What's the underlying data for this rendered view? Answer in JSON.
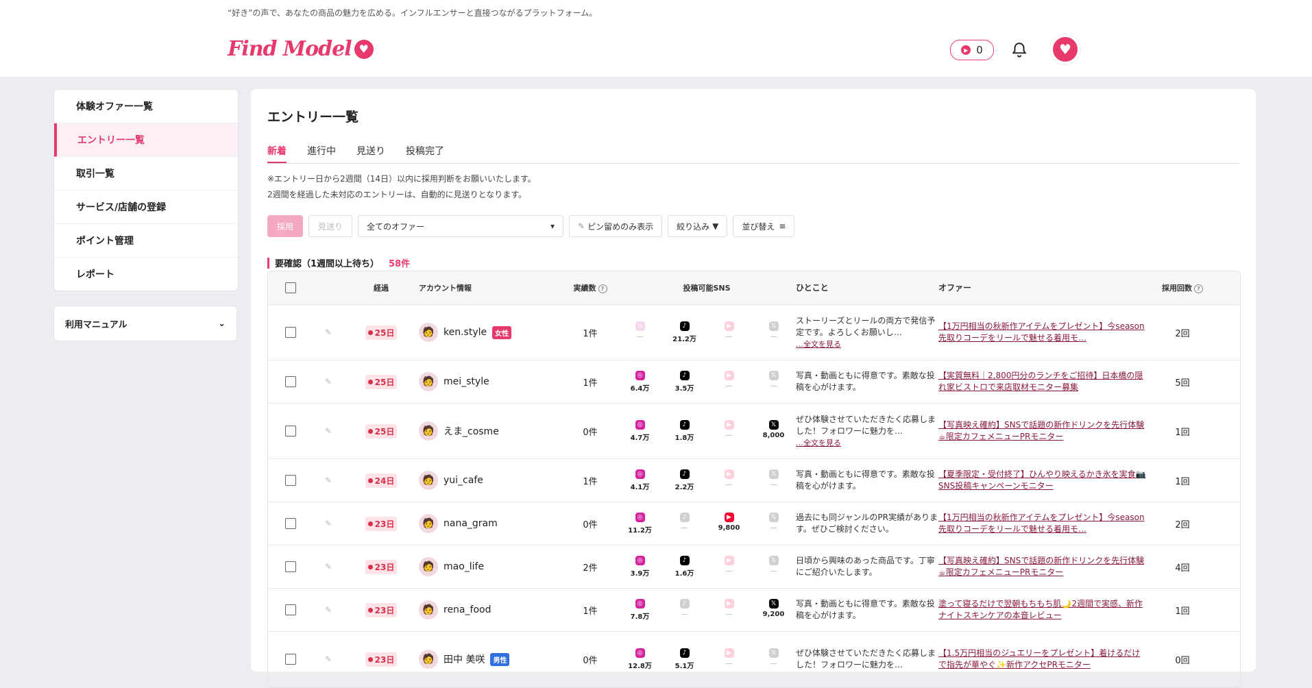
{
  "header": {
    "tagline": "“好き”の声で、あなたの商品の魅力を広める。インフルエンサーと直接つながるプラットフォーム。",
    "logo_text": "Find Model",
    "points": "0"
  },
  "sidebar": {
    "items": [
      {
        "label": "体験オファー一覧"
      },
      {
        "label": "エントリー一覧"
      },
      {
        "label": "取引一覧"
      },
      {
        "label": "サービス/店舗の登録"
      },
      {
        "label": "ポイント管理"
      },
      {
        "label": "レポート"
      }
    ],
    "manual_label": "利用マニュアル"
  },
  "main": {
    "title": "エントリー一覧",
    "tabs": [
      {
        "label": "新着"
      },
      {
        "label": "進行中"
      },
      {
        "label": "見送り"
      },
      {
        "label": "投稿完了"
      }
    ],
    "notes": [
      "※エントリー日から2週間（14日）以内に採用判断をお願いいたします。",
      "2週間を経過した未対応のエントリーは、自動的に見送りとなります。"
    ],
    "toolbar": {
      "adopt": "採用",
      "skip": "見送り",
      "offer_select": "全てのオファー",
      "pin_only": "ピン留めのみ表示",
      "filter": "絞り込み",
      "sort": "並び替え"
    },
    "section": {
      "title": "要確認（1週間以上待ち）",
      "count": "58件"
    },
    "columns": {
      "elapsed": "経過",
      "account": "アカウント情報",
      "results": "実績数",
      "sns": "投稿可能SNS",
      "message": "ひとこと",
      "offer": "オファー",
      "hire_count": "採用回数"
    },
    "more_label": "…全文を見る",
    "rows": [
      {
        "days": "25日",
        "name": "ken.style",
        "badge": "女性",
        "results": "1件",
        "ig": "—",
        "tt": "21.2万",
        "yt": "—",
        "x": "—",
        "message": "ストーリーズとリールの両方で発信予定です。よろしくお願いし…",
        "more": true,
        "offer": "【1万円相当の秋新作アイテムをプレゼント】今season先取りコーデをリールで魅せる着用モ…",
        "times": "2回"
      },
      {
        "days": "25日",
        "name": "mei_style",
        "badge": "",
        "results": "1件",
        "ig": "6.4万",
        "tt": "3.5万",
        "yt": "—",
        "x": "—",
        "message": "写真・動画ともに得意です。素敵な投稿を心がけます。",
        "more": false,
        "offer": "【実質無料｜2,800円分のランチをご招待】日本橋の隠れ家ビストロで来店取材モニター募集",
        "times": "5回"
      },
      {
        "days": "25日",
        "name": "えま_cosme",
        "badge": "",
        "results": "0件",
        "ig": "4.7万",
        "tt": "1.8万",
        "yt": "—",
        "x": "8,000",
        "message": "ぜひ体験させていただきたく応募しました！フォロワーに魅力を…",
        "more": true,
        "offer": "【写真映え確約】SNSで話題の新作ドリンクを先行体験☕限定カフェメニューPRモニター",
        "times": "1回"
      },
      {
        "days": "24日",
        "name": "yui_cafe",
        "badge": "",
        "results": "1件",
        "ig": "4.1万",
        "tt": "2.2万",
        "yt": "—",
        "x": "—",
        "message": "写真・動画ともに得意です。素敵な投稿を心がけます。",
        "more": false,
        "offer": "【夏季限定・受付終了】ひんやり映えるかき氷を実食📷SNS投稿キャンペーンモニター",
        "times": "1回"
      },
      {
        "days": "23日",
        "name": "nana_gram",
        "badge": "",
        "results": "0件",
        "ig": "11.2万",
        "tt": "—",
        "yt": "9,800",
        "x": "—",
        "message": "過去にも同ジャンルのPR実績があります。ぜひご検討ください。",
        "more": false,
        "offer": "【1万円相当の秋新作アイテムをプレゼント】今season先取りコーデをリールで魅せる着用モ…",
        "times": "2回"
      },
      {
        "days": "23日",
        "name": "mao_life",
        "badge": "",
        "results": "2件",
        "ig": "3.9万",
        "tt": "1.6万",
        "yt": "—",
        "x": "—",
        "message": "日頃から興味のあった商品です。丁寧にご紹介いたします。",
        "more": false,
        "offer": "【写真映え確約】SNSで話題の新作ドリンクを先行体験☕限定カフェメニューPRモニター",
        "times": "4回"
      },
      {
        "days": "23日",
        "name": "rena_food",
        "badge": "",
        "results": "1件",
        "ig": "7.8万",
        "tt": "—",
        "yt": "—",
        "x": "9,200",
        "message": "写真・動画ともに得意です。素敵な投稿を心がけます。",
        "more": false,
        "offer": "塗って寝るだけで翌朝もちもち肌🌙2週間で実感、新作ナイトスキンケアの本音レビュー",
        "times": "1回"
      },
      {
        "days": "23日",
        "name": "田中 美咲",
        "badge": "男性",
        "results": "0件",
        "ig": "12.8万",
        "tt": "5.1万",
        "yt": "—",
        "x": "—",
        "message": "ぜひ体験させていただきたく応募しました！フォロワーに魅力を…",
        "more": false,
        "offer": "【1.5万円相当のジュエリーをプレゼント】着けるだけで指先が華やぐ✨新作アクセPRモニター",
        "times": "0回"
      }
    ]
  }
}
